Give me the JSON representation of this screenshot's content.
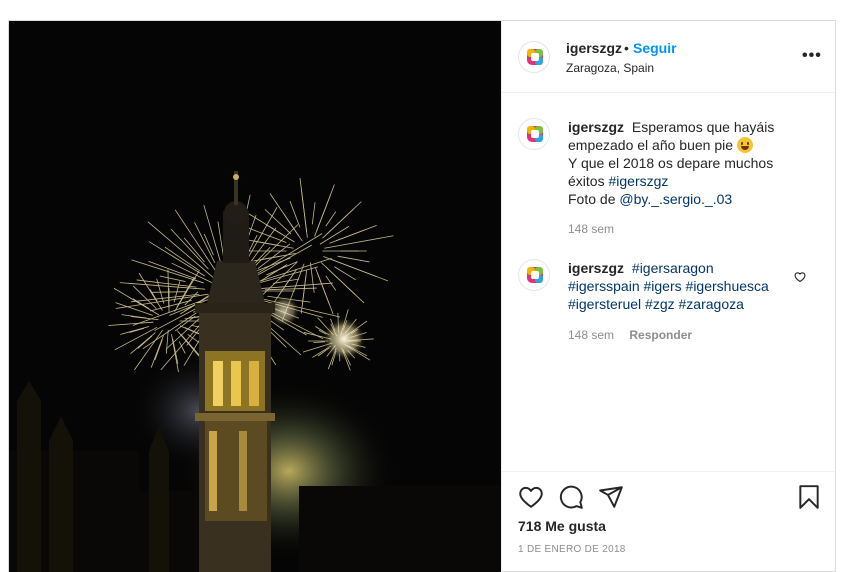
{
  "post": {
    "username": "igerszgz",
    "separator": "•",
    "follow_label": "Seguir",
    "location": "Zaragoza, Spain",
    "more_label": "•••"
  },
  "comments": [
    {
      "username": "igerszgz",
      "line1": "Esperamos que hayáis empezado el año buen pie",
      "line2": "Y que el 2018 os depare muchos éxitos",
      "hashtag": "#igerszgz",
      "photo_credit_prefix": "Foto de",
      "mention": "@by._.sergio._.03",
      "time": "148 sem"
    },
    {
      "username": "igerszgz",
      "hashtags": [
        "#igersaragon",
        "#igersspain",
        "#igers",
        "#igershuesca",
        "#igersteruel",
        "#zgz",
        "#zaragoza"
      ],
      "time": "148 sem",
      "reply_label": "Responder"
    }
  ],
  "likes": "718 Me gusta",
  "date": "1 DE ENERO DE 2018",
  "colors": {
    "accent": "#0095f6",
    "hashtag": "#00376b",
    "muted": "#8e8e8e",
    "text": "#262626",
    "border": "#dbdbdb"
  },
  "icons": {
    "like": "heart-icon",
    "comment": "comment-icon",
    "share": "share-icon",
    "save": "bookmark-icon",
    "options": "more-options-icon",
    "avatar": "igerszgz-logo"
  }
}
